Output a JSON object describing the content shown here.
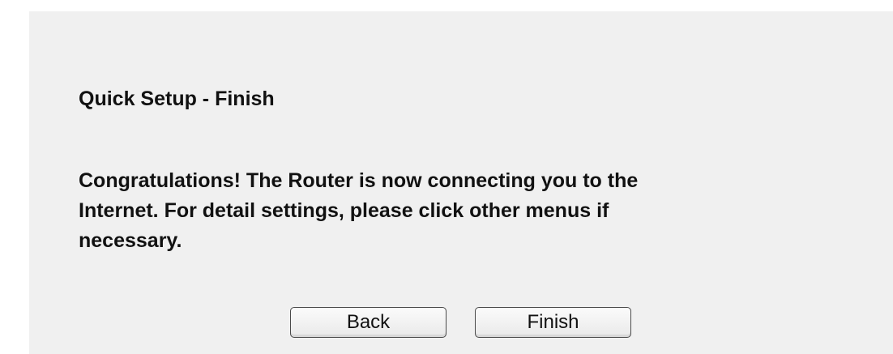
{
  "page": {
    "title": "Quick Setup - Finish",
    "message_lines": [
      "Congratulations! The Router is now connecting you to the",
      "Internet. For detail settings, please click other menus if",
      "necessary."
    ]
  },
  "buttons": {
    "back_label": "Back",
    "finish_label": "Finish"
  },
  "colors": {
    "panel_background": "#f0f0f0",
    "text": "#111111",
    "button_border": "#4a4a4a"
  }
}
